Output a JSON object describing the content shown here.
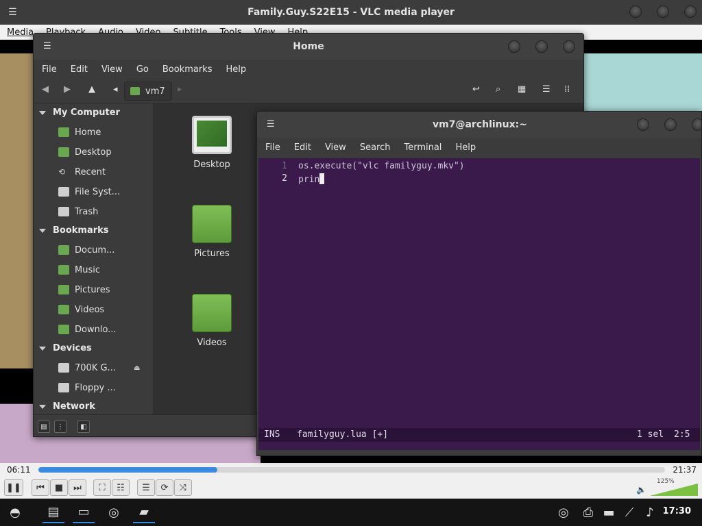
{
  "vlc": {
    "title": "Family.Guy.S22E15 - VLC media player",
    "menu": [
      "Media",
      "Playback",
      "Audio",
      "Video",
      "Subtitle",
      "Tools",
      "View",
      "Help"
    ],
    "time_elapsed": "06:11",
    "time_total": "21:37",
    "progress_fraction": 0.286,
    "volume": "125%"
  },
  "file_manager": {
    "title": "Home",
    "menu": [
      "File",
      "Edit",
      "View",
      "Go",
      "Bookmarks",
      "Help"
    ],
    "location": "vm7",
    "sidebar": {
      "my_computer": {
        "label": "My Computer",
        "items": [
          "Home",
          "Desktop",
          "Recent",
          "File Syst...",
          "Trash"
        ]
      },
      "bookmarks": {
        "label": "Bookmarks",
        "items": [
          "Docum...",
          "Music",
          "Pictures",
          "Videos",
          "Downlo..."
        ]
      },
      "devices": {
        "label": "Devices",
        "items": [
          "700K G...",
          "Floppy ..."
        ]
      },
      "network": {
        "label": "Network"
      }
    },
    "files": [
      "Desktop",
      "Pictures",
      "Videos"
    ]
  },
  "terminal": {
    "title": "vm7@archlinux:~",
    "menu": [
      "File",
      "Edit",
      "View",
      "Search",
      "Terminal",
      "Help"
    ],
    "lines": [
      {
        "number": "1",
        "text": "os.execute(\"vlc familyguy.mkv\")"
      },
      {
        "number": "2",
        "text": "prin"
      }
    ],
    "status": {
      "mode": "INS",
      "file": "familyguy.lua [+]",
      "selection": "1 sel",
      "position": "2:5"
    }
  },
  "taskbar": {
    "clock": "17:30"
  },
  "colors": {
    "accent": "#3a8be0",
    "folder_green": "#6aa84f",
    "terminal_bg": "#3a1a4a"
  }
}
